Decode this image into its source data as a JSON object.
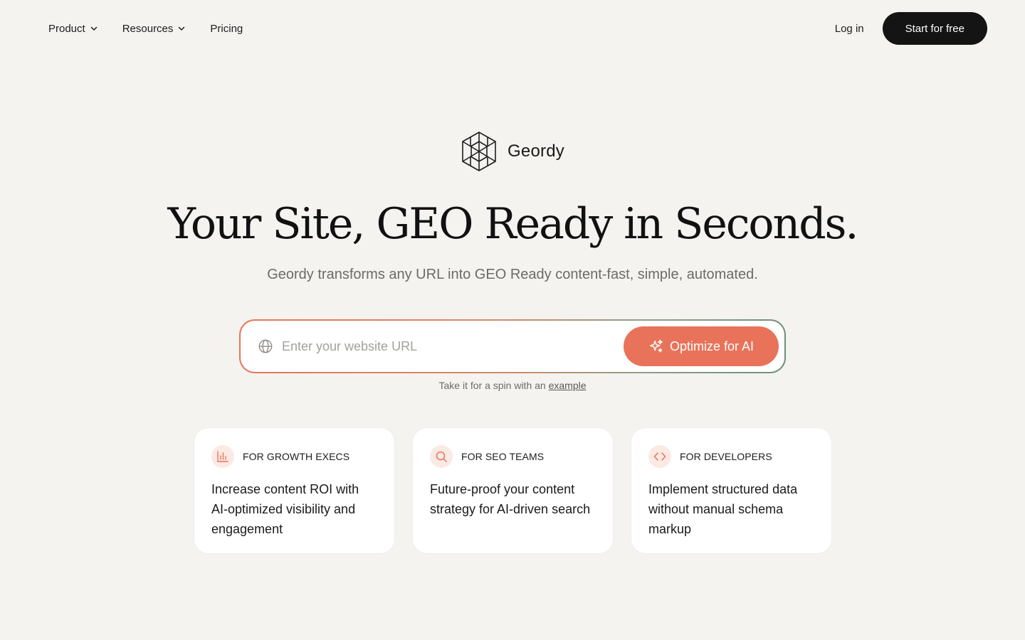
{
  "nav": {
    "items": [
      {
        "label": "Product",
        "has_menu": true
      },
      {
        "label": "Resources",
        "has_menu": true
      },
      {
        "label": "Pricing",
        "has_menu": false
      }
    ],
    "login_label": "Log in",
    "cta_label": "Start for free"
  },
  "brand": {
    "name": "Geordy",
    "logo_icon": "geordy-logo-icon"
  },
  "hero": {
    "headline": "Your Site, GEO Ready in Seconds.",
    "subheadline": "Geordy transforms any URL into GEO Ready content-fast, simple, automated."
  },
  "url_form": {
    "placeholder": "Enter your website URL",
    "value": "",
    "button_label": "Optimize for AI",
    "button_icon": "sparkle-icon",
    "input_icon": "globe-icon"
  },
  "example": {
    "prefix": "Take it for a spin with an",
    "link_label": "example"
  },
  "cards": [
    {
      "tag": "FOR GROWTH EXECS",
      "icon": "bar-chart-icon",
      "text": "Increase content ROI with AI-optimized visibility and engagement"
    },
    {
      "tag": "FOR SEO TEAMS",
      "icon": "search-icon",
      "text": "Future-proof your content strategy for AI-driven search"
    },
    {
      "tag": "FOR DEVELOPERS",
      "icon": "code-icon",
      "text": "Implement structured data without manual schema markup"
    }
  ],
  "colors": {
    "background": "#f4f3f0",
    "accent": "#e8735a",
    "cta_dark": "#141414",
    "icon_tint": "#fbe9e4"
  }
}
